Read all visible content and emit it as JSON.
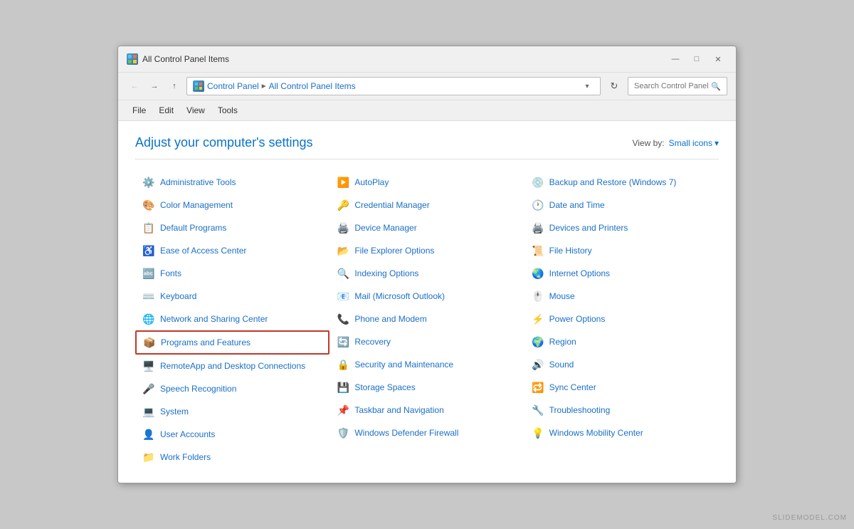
{
  "window": {
    "title": "All Control Panel Items",
    "icon": "🖥️"
  },
  "window_controls": {
    "minimize": "—",
    "maximize": "□",
    "close": "✕"
  },
  "address_bar": {
    "back_disabled": true,
    "forward_disabled": false,
    "up": true,
    "path_parts": [
      "Control Panel",
      "All Control Panel Items"
    ],
    "refresh": "↻"
  },
  "menu": {
    "items": [
      "File",
      "Edit",
      "View",
      "Tools"
    ]
  },
  "content": {
    "title": "Adjust your computer's settings",
    "view_by_label": "View by:",
    "view_by_value": "Small icons",
    "view_by_arrow": "▾"
  },
  "panel_items": {
    "col1": [
      {
        "icon": "⚙️",
        "label": "Administrative Tools",
        "highlighted": false
      },
      {
        "icon": "🎨",
        "label": "Color Management",
        "highlighted": false
      },
      {
        "icon": "📋",
        "label": "Default Programs",
        "highlighted": false
      },
      {
        "icon": "♿",
        "label": "Ease of Access Center",
        "highlighted": false
      },
      {
        "icon": "🔤",
        "label": "Fonts",
        "highlighted": false
      },
      {
        "icon": "⌨️",
        "label": "Keyboard",
        "highlighted": false
      },
      {
        "icon": "🌐",
        "label": "Network and Sharing Center",
        "highlighted": false
      },
      {
        "icon": "📦",
        "label": "Programs and Features",
        "highlighted": true
      },
      {
        "icon": "🖥️",
        "label": "RemoteApp and Desktop Connections",
        "highlighted": false
      },
      {
        "icon": "🎤",
        "label": "Speech Recognition",
        "highlighted": false
      },
      {
        "icon": "💻",
        "label": "System",
        "highlighted": false
      },
      {
        "icon": "👤",
        "label": "User Accounts",
        "highlighted": false
      },
      {
        "icon": "📁",
        "label": "Work Folders",
        "highlighted": false
      }
    ],
    "col2": [
      {
        "icon": "▶️",
        "label": "AutoPlay",
        "highlighted": false
      },
      {
        "icon": "🔑",
        "label": "Credential Manager",
        "highlighted": false
      },
      {
        "icon": "🖨️",
        "label": "Device Manager",
        "highlighted": false
      },
      {
        "icon": "📂",
        "label": "File Explorer Options",
        "highlighted": false
      },
      {
        "icon": "🔍",
        "label": "Indexing Options",
        "highlighted": false
      },
      {
        "icon": "📧",
        "label": "Mail (Microsoft Outlook)",
        "highlighted": false
      },
      {
        "icon": "📞",
        "label": "Phone and Modem",
        "highlighted": false
      },
      {
        "icon": "🔄",
        "label": "Recovery",
        "highlighted": false
      },
      {
        "icon": "🔒",
        "label": "Security and Maintenance",
        "highlighted": false
      },
      {
        "icon": "💾",
        "label": "Storage Spaces",
        "highlighted": false
      },
      {
        "icon": "📌",
        "label": "Taskbar and Navigation",
        "highlighted": false
      },
      {
        "icon": "🛡️",
        "label": "Windows Defender Firewall",
        "highlighted": false
      }
    ],
    "col3": [
      {
        "icon": "💿",
        "label": "Backup and Restore (Windows 7)",
        "highlighted": false
      },
      {
        "icon": "🕐",
        "label": "Date and Time",
        "highlighted": false
      },
      {
        "icon": "🖨️",
        "label": "Devices and Printers",
        "highlighted": false
      },
      {
        "icon": "📜",
        "label": "File History",
        "highlighted": false
      },
      {
        "icon": "🌏",
        "label": "Internet Options",
        "highlighted": false
      },
      {
        "icon": "🖱️",
        "label": "Mouse",
        "highlighted": false
      },
      {
        "icon": "⚡",
        "label": "Power Options",
        "highlighted": false
      },
      {
        "icon": "🌍",
        "label": "Region",
        "highlighted": false
      },
      {
        "icon": "🔊",
        "label": "Sound",
        "highlighted": false
      },
      {
        "icon": "🔁",
        "label": "Sync Center",
        "highlighted": false
      },
      {
        "icon": "🔧",
        "label": "Troubleshooting",
        "highlighted": false
      },
      {
        "icon": "💡",
        "label": "Windows Mobility Center",
        "highlighted": false
      }
    ]
  },
  "watermark": "SLIDEMODEL.COM"
}
